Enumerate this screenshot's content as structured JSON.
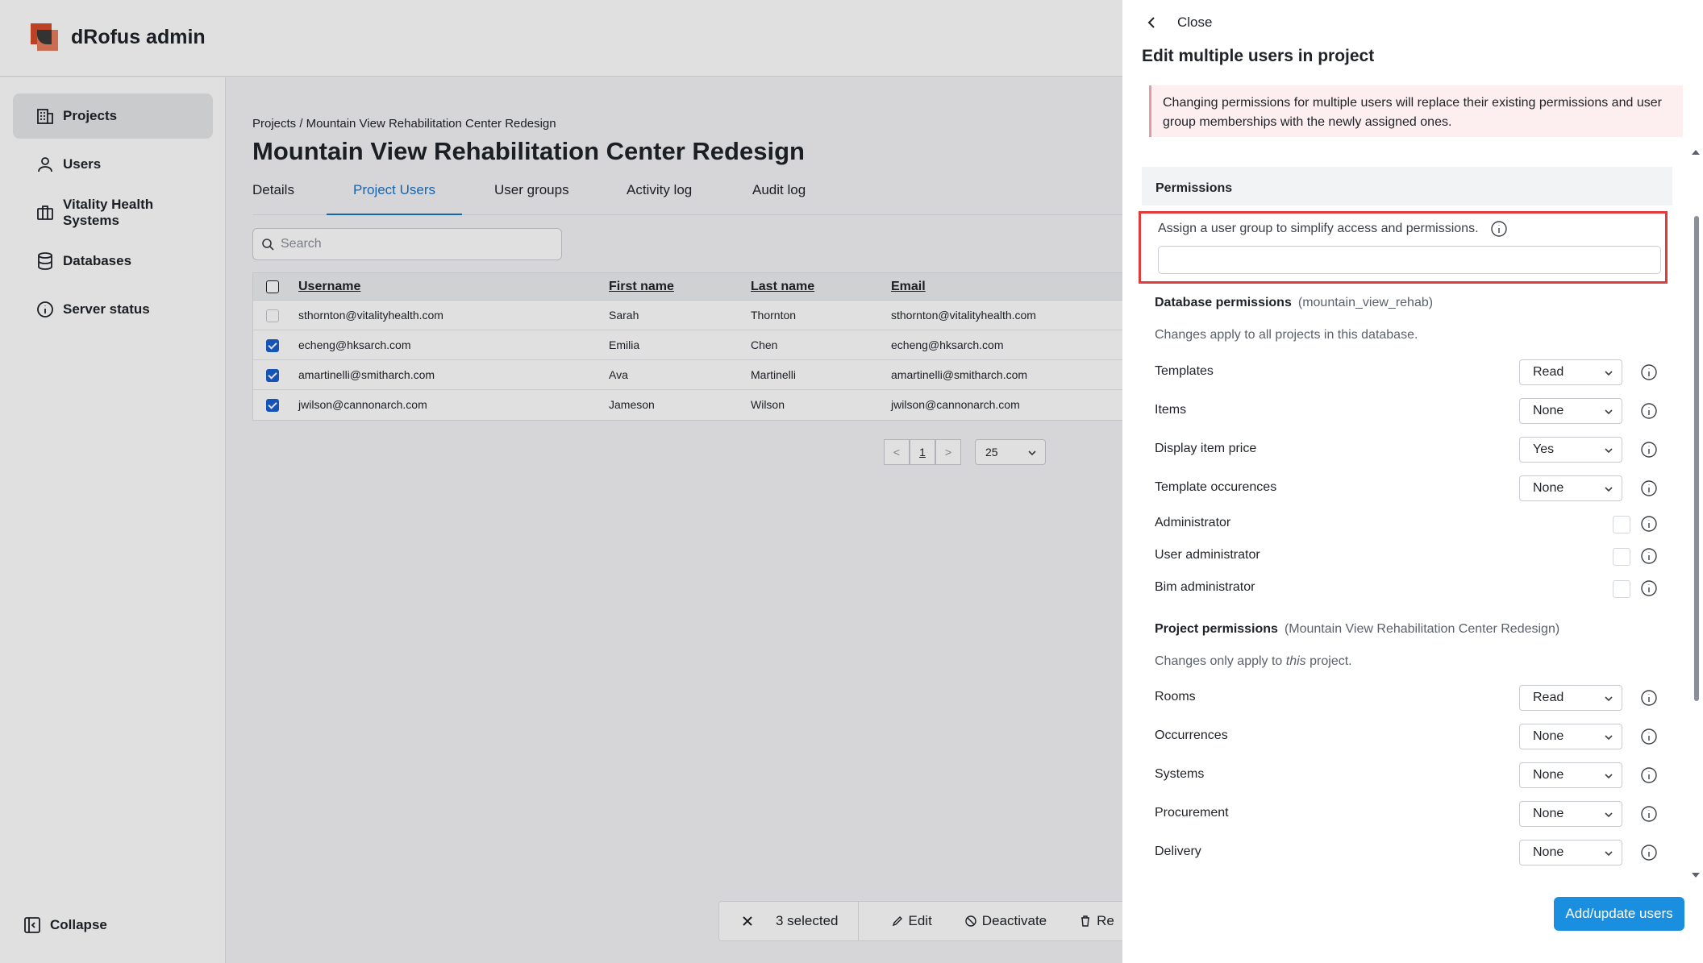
{
  "app": {
    "title": "dRofus admin"
  },
  "sidebar": {
    "items": [
      {
        "label": "Projects",
        "icon": "building-icon",
        "active": true
      },
      {
        "label": "Users",
        "icon": "user-icon",
        "active": false
      },
      {
        "label": "Vitality Health Systems",
        "icon": "briefcase-icon",
        "active": false
      },
      {
        "label": "Databases",
        "icon": "database-icon",
        "active": false
      },
      {
        "label": "Server status",
        "icon": "info-circle-icon",
        "active": false
      }
    ],
    "collapse_label": "Collapse"
  },
  "main": {
    "breadcrumb": "Projects / Mountain View Rehabilitation Center Redesign",
    "title": "Mountain View Rehabilitation Center Redesign",
    "tabs": [
      {
        "label": "Details",
        "active": false
      },
      {
        "label": "Project Users",
        "active": true
      },
      {
        "label": "User groups",
        "active": false
      },
      {
        "label": "Activity log",
        "active": false
      },
      {
        "label": "Audit log",
        "active": false
      }
    ],
    "search_placeholder": "Search",
    "table": {
      "columns": [
        "Username",
        "First name",
        "Last name",
        "Email"
      ],
      "rows": [
        {
          "username": "sthornton@vitalityhealth.com",
          "first": "Sarah",
          "last": "Thornton",
          "email": "sthornton@vitalityhealth.com",
          "checked": false
        },
        {
          "username": "echeng@hksarch.com",
          "first": "Emilia",
          "last": "Chen",
          "email": "echeng@hksarch.com",
          "checked": true
        },
        {
          "username": "amartinelli@smitharch.com",
          "first": "Ava",
          "last": "Martinelli",
          "email": "amartinelli@smitharch.com",
          "checked": true
        },
        {
          "username": "jwilson@cannonarch.com",
          "first": "Jameson",
          "last": "Wilson",
          "email": "jwilson@cannonarch.com",
          "checked": true
        }
      ]
    },
    "pagination": {
      "prev": "<",
      "page": "1",
      "next": ">",
      "page_size": "25"
    },
    "bulk_bar": {
      "selected": "3 selected",
      "edit": "Edit",
      "deactivate": "Deactivate",
      "remove": "Re"
    }
  },
  "panel": {
    "close_label": "Close",
    "title": "Edit multiple users in project",
    "warning": "Changing permissions for multiple users will replace their existing permissions and user group memberships with the newly assigned ones.",
    "permissions_heading": "Permissions",
    "group_label": "Assign a user group to simplify access and permissions.",
    "group_value": "",
    "database": {
      "title": "Database permissions",
      "subtitle": "(mountain_view_rehab)",
      "note": "Changes apply to all projects in this database.",
      "rows": [
        {
          "label": "Templates",
          "type": "select",
          "value": "Read"
        },
        {
          "label": "Items",
          "type": "select",
          "value": "None"
        },
        {
          "label": "Display item price",
          "type": "select",
          "value": "Yes"
        },
        {
          "label": "Template occurences",
          "type": "select",
          "value": "None"
        },
        {
          "label": "Administrator",
          "type": "checkbox",
          "value": false
        },
        {
          "label": "User administrator",
          "type": "checkbox",
          "value": false
        },
        {
          "label": "Bim administrator",
          "type": "checkbox",
          "value": false
        }
      ]
    },
    "project": {
      "title": "Project permissions",
      "subtitle": "(Mountain View Rehabilitation Center Redesign)",
      "note_prefix": "Changes only apply to ",
      "note_em": "this",
      "note_suffix": " project.",
      "rows": [
        {
          "label": "Rooms",
          "type": "select",
          "value": "Read"
        },
        {
          "label": "Occurrences",
          "type": "select",
          "value": "None"
        },
        {
          "label": "Systems",
          "type": "select",
          "value": "None"
        },
        {
          "label": "Procurement",
          "type": "select",
          "value": "None"
        },
        {
          "label": "Delivery",
          "type": "select",
          "value": "None"
        }
      ]
    },
    "submit_label": "Add/update users"
  },
  "colors": {
    "accent": "#1a73c8",
    "primary_button": "#1a8fe0",
    "highlight_border": "#e03a3a",
    "warning_bg": "#fdeef0"
  }
}
